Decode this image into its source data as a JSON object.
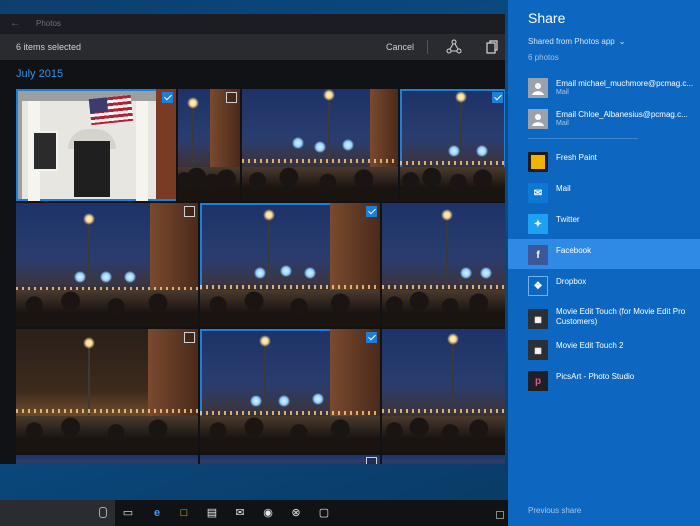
{
  "photos_window": {
    "app_title": "Photos",
    "selection_text": "6 items selected",
    "cancel_label": "Cancel",
    "month_label": "July 2015"
  },
  "photo_tiles": [
    {
      "kind": "house",
      "selected": true
    },
    {
      "kind": "night",
      "selected": false
    },
    {
      "kind": "night",
      "selected": false
    },
    {
      "kind": "night",
      "selected": true
    },
    {
      "kind": "night",
      "selected": false
    },
    {
      "kind": "night",
      "selected": true
    },
    {
      "kind": "night",
      "selected": false
    },
    {
      "kind": "warm",
      "selected": false
    },
    {
      "kind": "night",
      "selected": true
    },
    {
      "kind": "night",
      "selected": false
    }
  ],
  "share": {
    "title": "Share",
    "source": "Shared from Photos app",
    "count": "6 photos",
    "contacts": [
      {
        "name": "Email michael_muchmore@pcmag.c...",
        "sub": "Mail"
      },
      {
        "name": "Email Chloe_Albanesius@pcmag.c...",
        "sub": "Mail"
      }
    ],
    "apps": [
      {
        "name": "Fresh Paint",
        "icon": "fresh-paint-icon",
        "color": "#f0b400"
      },
      {
        "name": "Mail",
        "icon": "mail-icon",
        "color": "#0a78d4"
      },
      {
        "name": "Twitter",
        "icon": "twitter-icon",
        "color": "#1da1f2"
      },
      {
        "name": "Facebook",
        "icon": "facebook-icon",
        "color": "#3b5998"
      },
      {
        "name": "Dropbox",
        "icon": "dropbox-icon",
        "color": "#0d67c0"
      },
      {
        "name": "Movie Edit Touch (for Movie Edit Pro Customers)",
        "icon": "movie-edit-icon",
        "color": "#2b2f36"
      },
      {
        "name": "Movie Edit Touch 2",
        "icon": "movie-edit-2-icon",
        "color": "#2b2f36"
      },
      {
        "name": "PicsArt - Photo Studio",
        "icon": "picsart-icon",
        "color": "#1e2026"
      }
    ],
    "previous_share_label": "Previous share",
    "highlight_color": "#2f8ae6",
    "pane_color": "#0d67c0"
  },
  "taskbar": {
    "icons": [
      "task-view-icon",
      "edge-icon",
      "file-explorer-icon",
      "store-icon",
      "mail-icon",
      "groove-music-icon",
      "xbox-icon",
      "photos-icon"
    ]
  }
}
